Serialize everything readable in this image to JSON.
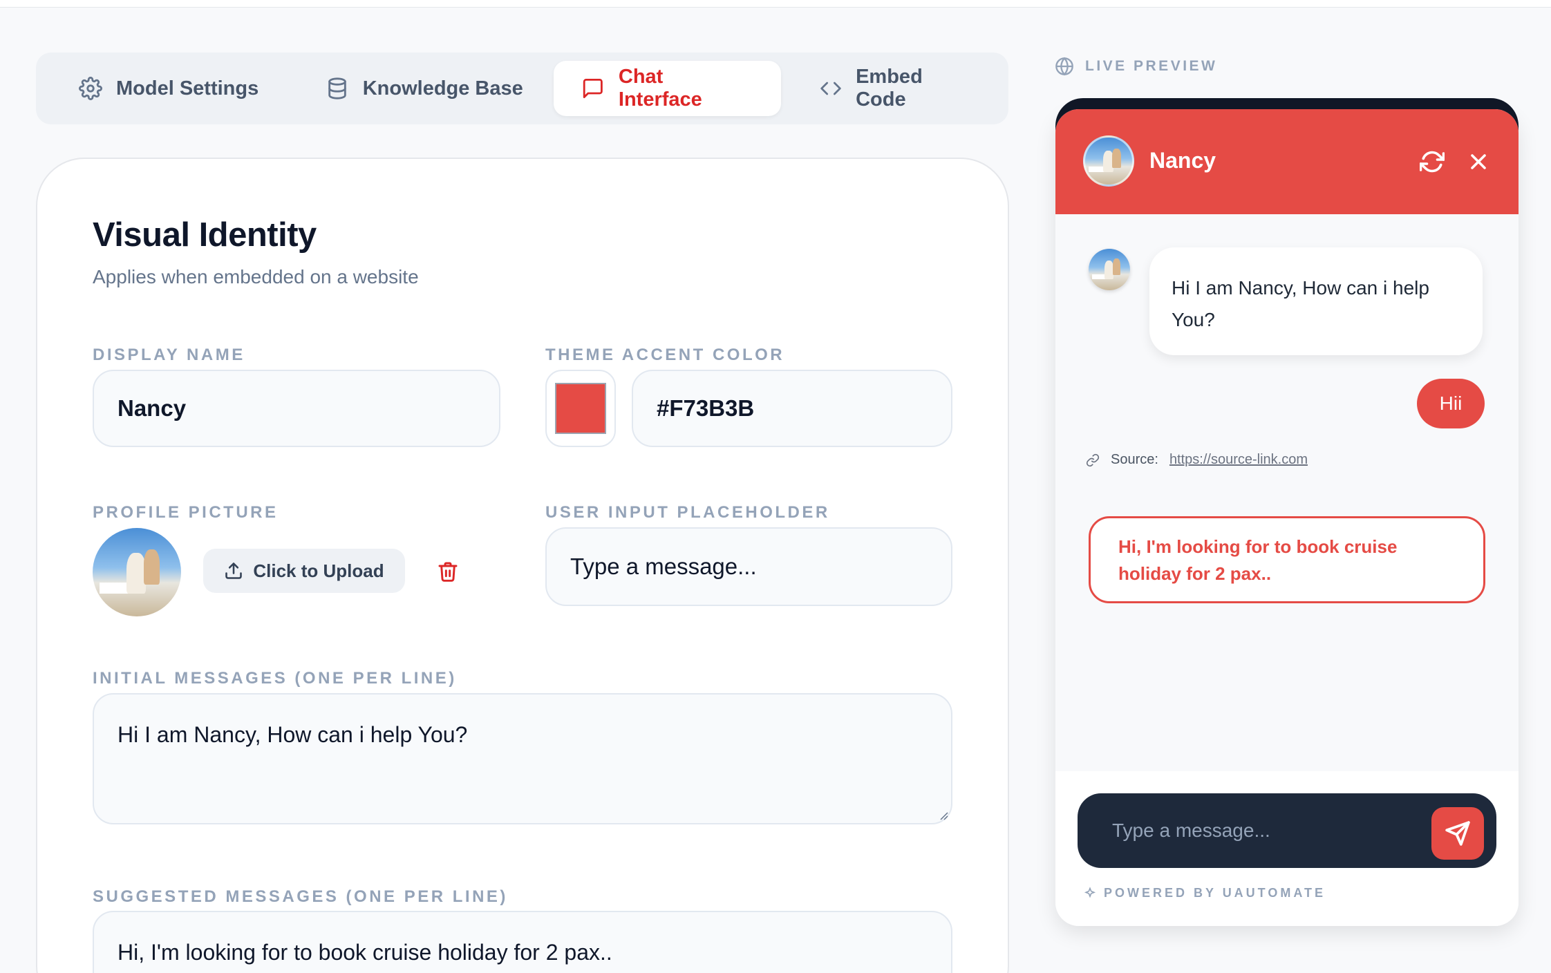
{
  "tabs": [
    {
      "label": "Model Settings",
      "icon": "gear-icon"
    },
    {
      "label": "Knowledge Base",
      "icon": "database-icon"
    },
    {
      "label": "Chat Interface",
      "icon": "chat-icon",
      "active": true
    },
    {
      "label": "Embed Code",
      "icon": "code-icon"
    }
  ],
  "form": {
    "title": "Visual Identity",
    "subtitle": "Applies when embedded on a website",
    "display_name_label": "DISPLAY NAME",
    "display_name_value": "Nancy",
    "accent_label": "THEME ACCENT COLOR",
    "accent_value": "#F73B3B",
    "accent_swatch": "#e54b45",
    "profile_label": "PROFILE PICTURE",
    "upload_label": "Click to Upload",
    "placeholder_label": "USER INPUT PLACEHOLDER",
    "placeholder_value": "Type a message...",
    "initial_label": "INITIAL MESSAGES (ONE PER LINE)",
    "initial_value": "Hi I am Nancy, How can i help You?",
    "suggested_label": "SUGGESTED MESSAGES (ONE PER LINE)",
    "suggested_value": "Hi, I'm looking for to book cruise holiday for 2 pax.."
  },
  "preview": {
    "label": "LIVE PREVIEW",
    "name": "Nancy",
    "bot_message": "Hi I am Nancy, How can i help You?",
    "user_message": "Hii",
    "source_label": "Source:",
    "source_link": "https://source-link.com",
    "suggestion": "Hi, I'm looking for to book cruise holiday for 2 pax..",
    "input_placeholder": "Type a message...",
    "powered_by": "POWERED BY UAUTOMATE",
    "accent": "#e54b45"
  }
}
